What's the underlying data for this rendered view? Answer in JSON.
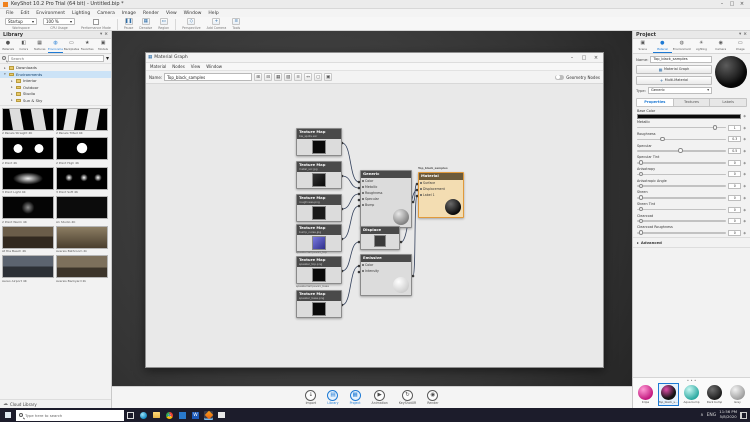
{
  "icons": {
    "close": "×",
    "maximize": "□",
    "minimize": "–",
    "chevron_down": "▾",
    "caret_right": "▸",
    "caret_down": "▾",
    "dots": "• • •",
    "plus": "+",
    "diamond": "◆",
    "cloud": "☁",
    "node": "▦",
    "chevron_up": "∧"
  },
  "app": {
    "title": "KeyShot 10.2 Pro Trial (64 bit) - Untitled.bip *",
    "menu": [
      "File",
      "Edit",
      "Environment",
      "Lighting",
      "Camera",
      "Image",
      "Render",
      "View",
      "Window",
      "Help"
    ],
    "toolbar": {
      "workspace_label": "Workspace",
      "workspace_value": "Startup",
      "cpu_label": "CPU Usage",
      "cpu_value": "100 %",
      "performance_label": "Performance Mode",
      "icon_buttons": [
        "Pause",
        "Denoise",
        "Region",
        "Perspective",
        "Add Camera",
        "Tools"
      ]
    }
  },
  "library": {
    "title": "Library",
    "tabs": [
      "Materials",
      "Colors",
      "Textures",
      "Environments",
      "Backplates",
      "Favorites",
      "Models"
    ],
    "search_placeholder": "Search",
    "tree": [
      "Downloads",
      "Environments",
      "Interior",
      "Outdoor",
      "Studio",
      "Sun & Sky"
    ],
    "thumbs": [
      "2 Panels Straight 4K",
      "2 Panels Tilted 4K",
      "2 Point 4K",
      "2 Point High 4K",
      "3 Point Light 4K",
      "3 Point Soft 4K",
      "2 Point Warm 4K",
      "A1 Studio 4K",
      "At the Beach 4K",
      "Aversis Bathroom 2k",
      "Aereo Airport 4K",
      "Aversis Backyard 2k"
    ],
    "footer": "Cloud Library"
  },
  "graph": {
    "window_title": "Material Graph",
    "menus": [
      "Material",
      "Nodes",
      "View",
      "Window"
    ],
    "name_label": "Name:",
    "name_value": "Top_black_samples",
    "geometry_nodes_label": "Geometry Nodes",
    "texture_nodes": [
      {
        "title": "Texture Map",
        "sub": "bw_spots.exr"
      },
      {
        "title": "Texture Map",
        "sub": "metal_scr.jpg"
      },
      {
        "title": "Texture Map",
        "sub": "roughness.png"
      },
      {
        "title": "Texture Map",
        "sub": "bump_noise.jpg"
      },
      {
        "title": "Texture Map",
        "sub": "speaker_top.png",
        "caption": "speakerlampeva1_top"
      },
      {
        "title": "Texture Map",
        "sub": "speaker_base.png",
        "caption": "speakerlampeva1_base"
      }
    ],
    "generic_node": {
      "title": "Generic",
      "inputs": [
        "Color",
        "Metallic",
        "Roughness",
        "Specular",
        "Bump"
      ]
    },
    "displace_node": {
      "title": "Displace"
    },
    "emissive_node": {
      "title": "Emissive",
      "inputs": [
        "Color",
        "Intensity"
      ]
    },
    "material_node": {
      "caption": "Top_black_samples",
      "title": "Material",
      "inputs": [
        "Surface",
        "Displacement",
        "Label 1"
      ]
    }
  },
  "project": {
    "title": "Project",
    "tabs": [
      "Scene",
      "Material",
      "Environment",
      "Lighting",
      "Camera",
      "Image"
    ],
    "name_label": "Name:",
    "name_value": "Top_black_samples",
    "material_graph_button": "Material Graph",
    "multi_material_button": "Multi-Material",
    "type_label": "Type:",
    "type_value": "Generic",
    "subtabs": [
      "Properties",
      "Textures",
      "Labels"
    ],
    "properties": [
      {
        "label": "Base Color",
        "value": ""
      },
      {
        "label": "Metallic",
        "value": "1"
      },
      {
        "label": "Roughness",
        "value": "0.3"
      },
      {
        "label": "Specular",
        "value": "0.5"
      },
      {
        "label": "Specular Tint",
        "value": "0"
      },
      {
        "label": "Anisotropy",
        "value": "0"
      },
      {
        "label": "Anisotropic Angle",
        "value": "0"
      },
      {
        "label": "Sheen",
        "value": "0"
      },
      {
        "label": "Sheen Tint",
        "value": "0"
      },
      {
        "label": "Clearcoat",
        "value": "0"
      },
      {
        "label": "Clearcoat Roughness",
        "value": "0"
      }
    ],
    "advanced_label": "Advanced",
    "materials_strip": [
      "Kripa",
      "Top_black_samples",
      "Aqua bump",
      "Dark bump",
      "Grey"
    ]
  },
  "ribbon": {
    "items": [
      "Import",
      "Library",
      "Project",
      "Animation",
      "KeyShotXR",
      "Render"
    ]
  },
  "taskbar": {
    "search_placeholder": "Type here to search",
    "lang": "ENG",
    "time": "11:56 PM",
    "date": "5/8/2020"
  }
}
